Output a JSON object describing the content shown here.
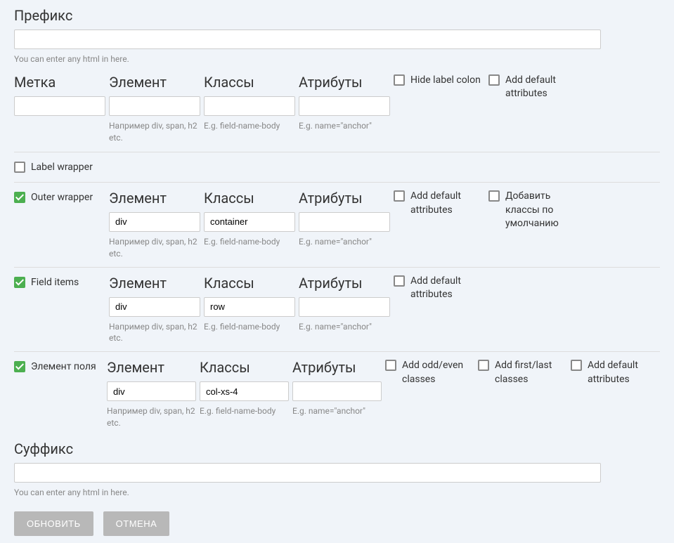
{
  "prefix": {
    "label": "Префикс",
    "value": "",
    "hint": "You can enter any html in here."
  },
  "mainRow": {
    "metkaLabel": "Метка",
    "metkaValue": "",
    "elementLabel": "Элемент",
    "elementValue": "",
    "elementHint": "Например div, span, h2 etc.",
    "classesLabel": "Классы",
    "classesValue": "",
    "classesHint": "E.g. field-name-body",
    "attrsLabel": "Атрибуты",
    "attrsValue": "",
    "attrsHint": "E.g. name=\"anchor\"",
    "hideLabelColon": "Hide label colon",
    "addDefaultAttrs": "Add default attributes"
  },
  "labelWrapper": {
    "toggle": "Label wrapper"
  },
  "outerWrapper": {
    "toggle": "Outer wrapper",
    "elementLabel": "Элемент",
    "elementValue": "div",
    "elementHint": "Например div, span, h2 etc.",
    "classesLabel": "Классы",
    "classesValue": "container",
    "classesHint": "E.g. field-name-body",
    "attrsLabel": "Атрибуты",
    "attrsValue": "",
    "attrsHint": "E.g. name=\"anchor\"",
    "addDefaultAttrs": "Add default attributes",
    "addDefaultClasses": "Добавить классы по умолчанию"
  },
  "fieldItems": {
    "toggle": "Field items",
    "elementLabel": "Элемент",
    "elementValue": "div",
    "elementHint": "Например div, span, h2 etc.",
    "classesLabel": "Классы",
    "classesValue": "row",
    "classesHint": "E.g. field-name-body",
    "attrsLabel": "Атрибуты",
    "attrsValue": "",
    "attrsHint": "E.g. name=\"anchor\"",
    "addDefaultAttrs": "Add default attributes"
  },
  "elementPolya": {
    "toggle": "Элемент поля",
    "elementLabel": "Элемент",
    "elementValue": "div",
    "elementHint": "Например div, span, h2 etc.",
    "classesLabel": "Классы",
    "classesValue": "col-xs-4",
    "classesHint": "E.g. field-name-body",
    "attrsLabel": "Атрибуты",
    "attrsValue": "",
    "attrsHint": "E.g. name=\"anchor\"",
    "addOddEven": "Add odd/even classes",
    "addFirstLast": "Add first/last classes",
    "addDefaultAttrs": "Add default attributes"
  },
  "suffix": {
    "label": "Суффикс",
    "value": "",
    "hint": "You can enter any html in here."
  },
  "buttons": {
    "submit": "ОБНОВИТЬ",
    "cancel": "ОТМЕНА"
  }
}
